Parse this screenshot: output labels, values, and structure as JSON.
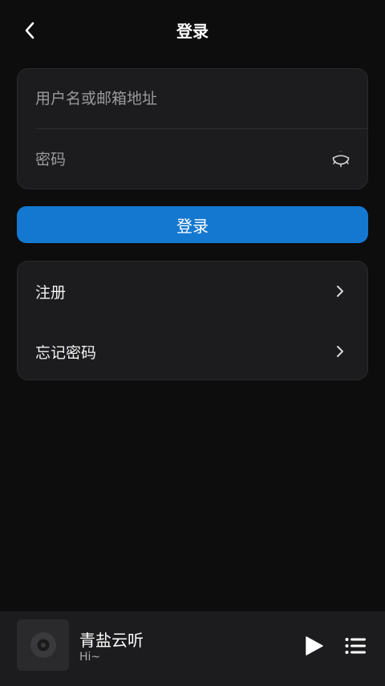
{
  "header": {
    "title": "登录",
    "back_icon": "chevron-left-icon"
  },
  "login_form": {
    "username": {
      "placeholder": "用户名或邮箱地址",
      "value": ""
    },
    "password": {
      "placeholder": "密码",
      "value": "",
      "toggle_icon": "eye-closed-icon"
    },
    "submit_label": "登录"
  },
  "menu": {
    "items": [
      {
        "label": "注册",
        "icon": "chevron-right-icon"
      },
      {
        "label": "忘记密码",
        "icon": "chevron-right-icon"
      }
    ]
  },
  "player": {
    "cover_icon": "disc-icon",
    "title": "青盐云听",
    "subtitle": "Hi~",
    "play_icon": "play-icon",
    "playlist_icon": "playlist-icon"
  },
  "colors": {
    "background": "#0d0d0d",
    "card": "#1c1c1e",
    "accent": "#1478d0",
    "text": "#f2f2f2",
    "muted": "#9a9a9e"
  }
}
